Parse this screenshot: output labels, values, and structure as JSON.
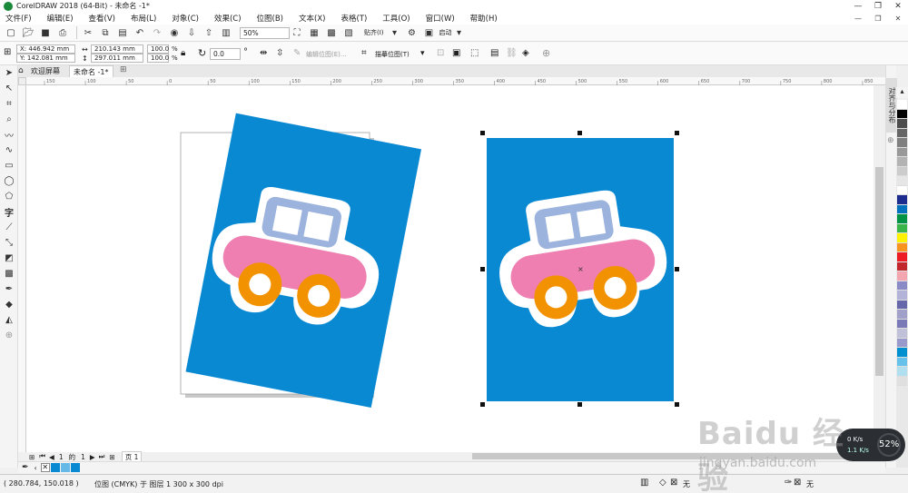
{
  "window": {
    "title": "CorelDRAW 2018 (64-Bit) - 未命名 -1*",
    "controls": [
      "—",
      "❐",
      "✕"
    ]
  },
  "menu": [
    "文件(F)",
    "编辑(E)",
    "查看(V)",
    "布局(L)",
    "对象(C)",
    "效果(C)",
    "位图(B)",
    "文本(X)",
    "表格(T)",
    "工具(O)",
    "窗口(W)",
    "帮助(H)"
  ],
  "menu_right": [
    "—",
    "❐",
    "✕"
  ],
  "std_toolbar": {
    "zoom": "50%",
    "snap_label": "贴齐(I)",
    "launch_label": "启动"
  },
  "property_bar": {
    "x": "X: 446.942 mm",
    "y": "Y: 142.081 mm",
    "w": "210.143 mm",
    "h": "297.011 mm",
    "scale_w": "100.0",
    "scale_h": "100.0",
    "pct": "%",
    "angle": "0.0",
    "edit_bitmap": "编辑位图(E)...",
    "trace_bitmap": "描摹位图(T)"
  },
  "tabs": {
    "welcome": "欢迎屏幕",
    "doc": "未命名 -1*"
  },
  "ruler": {
    "ticks": [
      "150",
      "100",
      "50",
      "0",
      "50",
      "100",
      "150",
      "200",
      "250",
      "300",
      "350",
      "400",
      "450",
      "500",
      "550",
      "600",
      "650",
      "700",
      "750",
      "800",
      "850"
    ]
  },
  "page_nav": {
    "page_num": "1",
    "of": "的",
    "total": "1",
    "page_tab": "页 1"
  },
  "docker": {
    "vertical_tab": "对齐与分布"
  },
  "status": {
    "coords": "( 280.784, 150.018 )",
    "info": "位图 (CMYK) 于 图层 1 300 x 300 dpi",
    "fill_none": "无",
    "outline_none": "无"
  },
  "net_widget": {
    "percent": "52%",
    "up": "0 K/s",
    "down": "1.1 K/s"
  },
  "watermark": {
    "logo": "Baidu 经验",
    "url": "jingyan.baidu.com"
  },
  "colors": {
    "card_blue": "#0a89d3",
    "car_body_pink": "#ee7fb0",
    "car_cabin_blue": "#9bb3dd",
    "wheel_orange": "#f39200",
    "handle_black": "#111111"
  },
  "palette": [
    "#ffffff",
    "#000000",
    "#4d4d4d",
    "#666666",
    "#808080",
    "#999999",
    "#b3b3b3",
    "#cccccc",
    "#e6e6e6",
    "#ffffff",
    "#1d2c8f",
    "#0071bc",
    "#009245",
    "#39b54a",
    "#fff200",
    "#f7931e",
    "#ed1c24",
    "#c1272d",
    "#f4a6b0",
    "#8a8ac6",
    "#b3b3d9",
    "#6666aa",
    "#a0a0c8",
    "#7a7ab8",
    "#c0c0d8",
    "#9999cc",
    "#0090d0",
    "#66c2ea",
    "#b0e0f0",
    "#e0e0e0"
  ]
}
